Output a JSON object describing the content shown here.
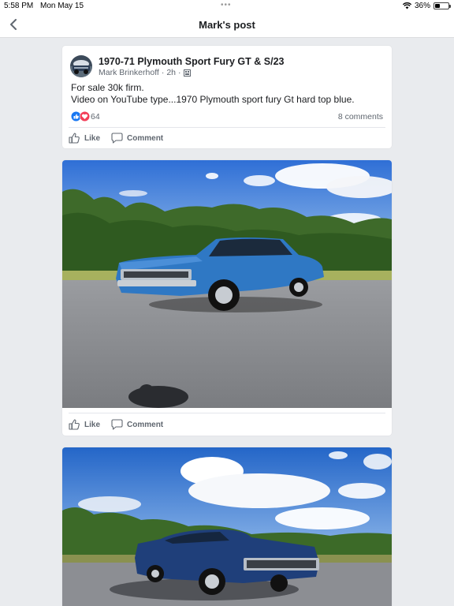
{
  "status": {
    "time": "5:58 PM",
    "date": "Mon May 15",
    "dots": "•••",
    "battery": "36%",
    "battery_level": 0.36
  },
  "nav": {
    "title": "Mark's post"
  },
  "post": {
    "title": "1970-71 Plymouth Sport Fury GT & S/23",
    "author": "Mark Brinkerhoff",
    "time": "2h",
    "dot": "·",
    "body_line1": "For sale 30k firm.",
    "body_line2": "Video on YouTube type...1970 Plymouth sport fury Gt hard top blue.",
    "reaction_count": "64",
    "comments": "8 comments",
    "like_label": "Like",
    "comment_label": "Comment"
  },
  "photo1": {
    "like_label": "Like",
    "comment_label": "Comment"
  },
  "colors": {
    "like_blue": "#1877f2",
    "love_red": "#f33e58",
    "car_blue": "#2f78c4"
  }
}
